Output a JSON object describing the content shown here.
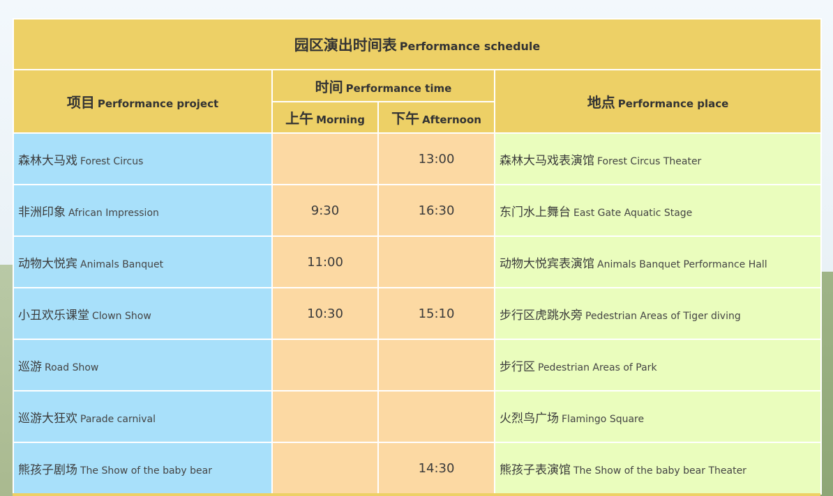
{
  "title": {
    "zh": "园区演出时间表",
    "en": "Performance schedule"
  },
  "headers": {
    "project": {
      "zh": "项目",
      "en": "Performance project"
    },
    "time": {
      "zh": "时间",
      "en": "Performance time"
    },
    "morning": {
      "zh": "上午",
      "en": "Morning"
    },
    "afternoon": {
      "zh": "下午",
      "en": "Afternoon"
    },
    "place": {
      "zh": "地点",
      "en": "Performance place"
    }
  },
  "rows": [
    {
      "project_zh": "森林大马戏",
      "project_en": "Forest Circus",
      "morning": "",
      "afternoon": "13:00",
      "place_zh": "森林大马戏表演馆",
      "place_en": "Forest Circus Theater"
    },
    {
      "project_zh": "非洲印象",
      "project_en": "African Impression",
      "morning": "9:30",
      "afternoon": "16:30",
      "place_zh": "东门水上舞台",
      "place_en": "East Gate Aquatic Stage"
    },
    {
      "project_zh": "动物大悦宾",
      "project_en": "Animals Banquet",
      "morning": "11:00",
      "afternoon": "",
      "place_zh": "动物大悦宾表演馆",
      "place_en": "Animals Banquet Performance Hall"
    },
    {
      "project_zh": "小丑欢乐课堂",
      "project_en": "Clown Show",
      "morning": "10:30",
      "afternoon": "15:10",
      "place_zh": "步行区虎跳水旁",
      "place_en": "Pedestrian Areas of Tiger diving"
    },
    {
      "project_zh": "巡游",
      "project_en": "Road Show",
      "morning": "",
      "afternoon": "",
      "place_zh": "步行区",
      "place_en": "Pedestrian Areas of Park"
    },
    {
      "project_zh": "巡游大狂欢",
      "project_en": "Parade carnival",
      "morning": "",
      "afternoon": "",
      "place_zh": "火烈鸟广场",
      "place_en": "Flamingo Square"
    },
    {
      "project_zh": "熊孩子剧场",
      "project_en": "The Show of the baby bear",
      "morning": "",
      "afternoon": "14:30",
      "place_zh": "熊孩子表演馆",
      "place_en": "The Show of the baby bear Theater"
    }
  ],
  "colors": {
    "header": "#edd066",
    "project_col": "#a8e0fa",
    "time_col": "#fcd9a3",
    "place_col": "#eafdbd"
  }
}
